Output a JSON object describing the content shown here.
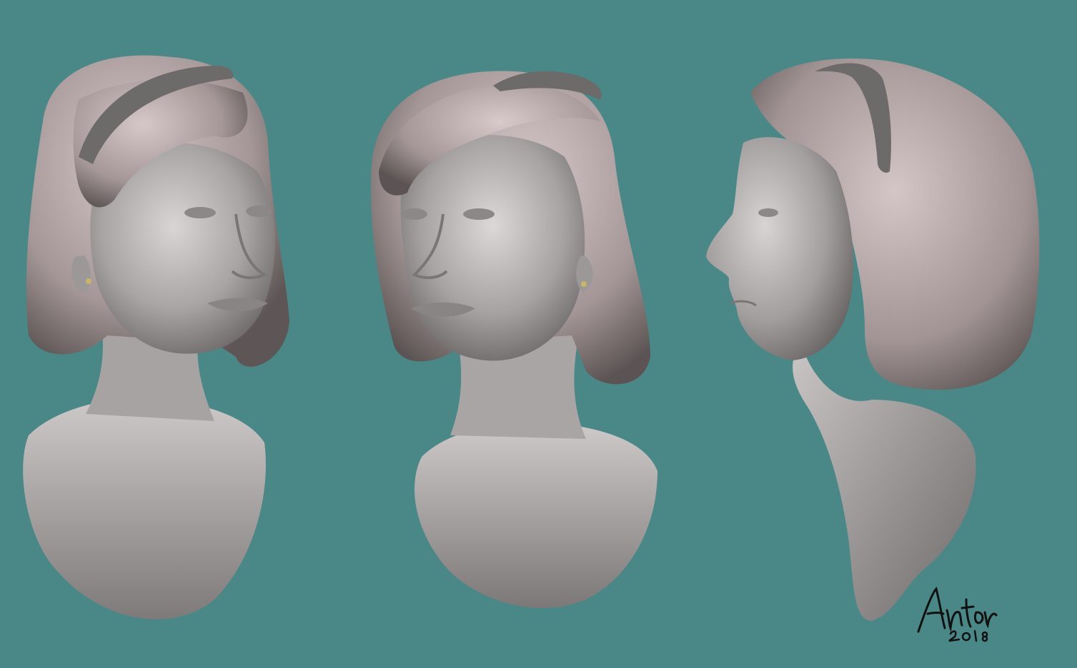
{
  "scene": {
    "background_color": "#4a8787",
    "clay_color": "#b8b3b3",
    "hair_color": "#b9a9aa",
    "headband_color": "#6d6a6a",
    "earring_color": "#c9b46a"
  },
  "views": [
    {
      "name": "three-quarter-left"
    },
    {
      "name": "three-quarter-front"
    },
    {
      "name": "profile-right"
    }
  ],
  "signature": {
    "text": "Anton 2018"
  }
}
